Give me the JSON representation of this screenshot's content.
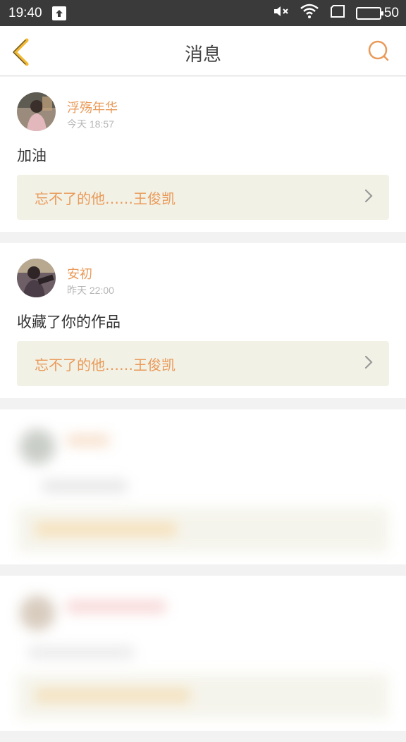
{
  "status_bar": {
    "time": "19:40",
    "battery": "50",
    "icons": [
      "upload-icon",
      "mute-icon",
      "wifi-icon",
      "sim-icon",
      "battery-icon"
    ]
  },
  "nav": {
    "title": "消息",
    "back_icon": "chevron-left-icon",
    "search_icon": "search-icon"
  },
  "messages": [
    {
      "username": "浮殇年华",
      "time": "今天 18:57",
      "content": "加油",
      "work_title": "忘不了的他……王俊凯"
    },
    {
      "username": "安初",
      "time": "昨天 22:00",
      "content": "收藏了你的作品",
      "work_title": "忘不了的他……王俊凯"
    }
  ],
  "colors": {
    "accent": "#e99a59",
    "status_bar": "#3a3a3a",
    "reference_bg": "#f2f1e6",
    "back_icon": "#f2b82e"
  }
}
